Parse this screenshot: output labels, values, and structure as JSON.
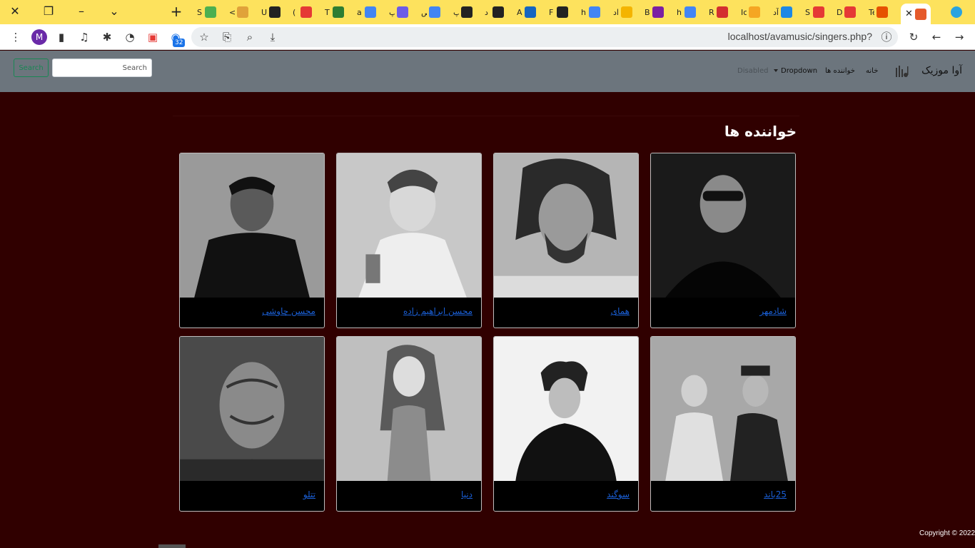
{
  "browser": {
    "url": "localhost/avamusic/singers.php?",
    "profile_initial": "M",
    "extension_badge": "32",
    "tab_glyphs": [
      "S",
      "<",
      "U",
      "(",
      "T",
      "a",
      "پ",
      "ص",
      "پ",
      "د",
      "A",
      "F",
      "h",
      "اد",
      "B",
      "h",
      "R",
      "Ic",
      "آد",
      "S",
      "D",
      "Te"
    ],
    "tab_colors": [
      "#4caf50",
      "#e0a23a",
      "#222222",
      "#e53935",
      "#2e7d32",
      "#4285f4",
      "#6c5ce7",
      "#4285f4",
      "#222222",
      "#222222",
      "#1565c0",
      "#222222",
      "#4285f4",
      "#f4b400",
      "#7b1fa2",
      "#4285f4",
      "#d32f2f",
      "#f5a623",
      "#1e88e5",
      "#e53935",
      "#e53935",
      "#e65100"
    ]
  },
  "nav": {
    "brand": "آوا موزیک",
    "home": "خانه",
    "singers": "خواننده ها",
    "dropdown": "Dropdown",
    "disabled": "Disabled",
    "search_placeholder": "Search",
    "search_button": "Search"
  },
  "page": {
    "title": "خواننده ها",
    "singers": [
      "شادمهر",
      "همای",
      "محسن ابراهیم زاده",
      "محسن چاوشی",
      "25باند",
      "سوگند",
      "دنیا",
      "تتلو"
    ],
    "copyright": "Copyright © 2022"
  }
}
